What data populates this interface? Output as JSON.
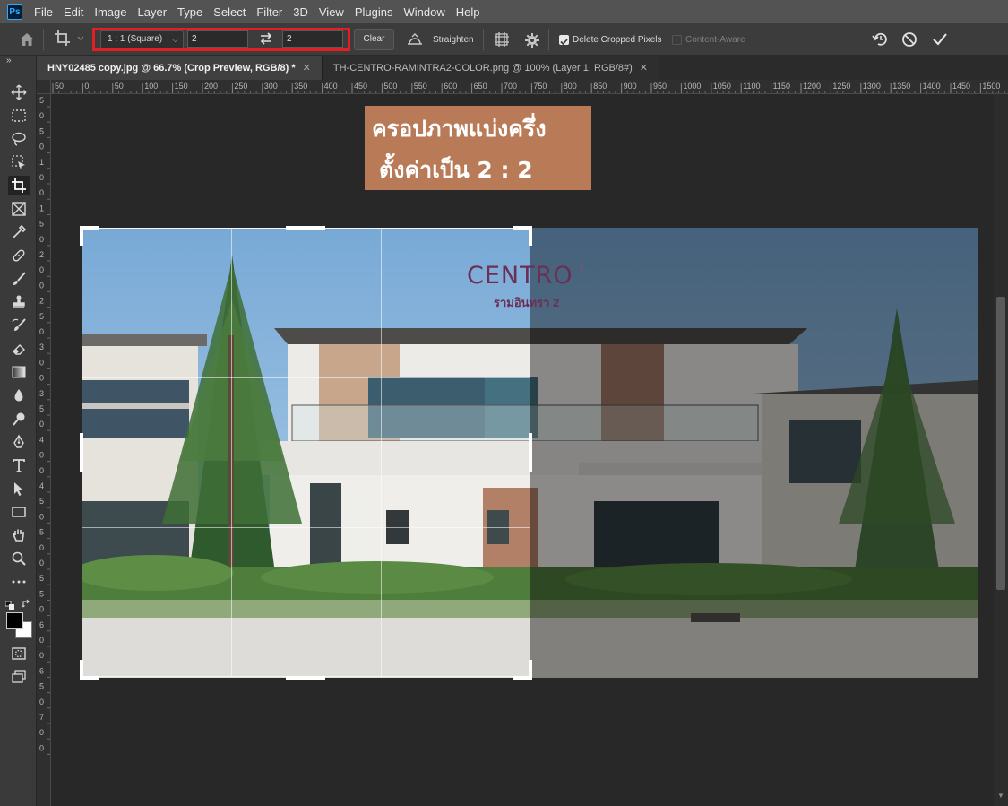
{
  "menu": [
    "File",
    "Edit",
    "Image",
    "Layer",
    "Type",
    "Select",
    "Filter",
    "3D",
    "View",
    "Plugins",
    "Window",
    "Help"
  ],
  "app_logo": "Ps",
  "options": {
    "ratio_preset": "1 : 1 (Square)",
    "width_value": "2",
    "height_value": "2",
    "clear_label": "Clear",
    "straighten_label": "Straighten",
    "delete_cropped_label": "Delete Cropped Pixels",
    "delete_cropped_checked": true,
    "content_aware_label": "Content-Aware",
    "content_aware_checked": false
  },
  "tabs": [
    {
      "label": "HNY02485 copy.jpg @ 66.7% (Crop Preview, RGB/8) *",
      "active": true
    },
    {
      "label": "TH-CENTRO-RAMINTRA2-COLOR.png @ 100% (Layer 1, RGB/8#)",
      "active": false
    }
  ],
  "ruler_top_labels": [
    "50",
    "0",
    "50",
    "100",
    "150",
    "200",
    "250",
    "300",
    "350",
    "400",
    "450",
    "500",
    "550",
    "600",
    "650",
    "700",
    "750",
    "800",
    "850",
    "900",
    "950",
    "1000",
    "1050",
    "1100",
    "1150",
    "1200",
    "1250",
    "1300",
    "1350",
    "1400",
    "1450",
    "1500"
  ],
  "ruler_left_labels": [
    "5",
    "0",
    "5",
    "0",
    "1",
    "0",
    "0",
    "1",
    "5",
    "0",
    "2",
    "0",
    "0",
    "2",
    "5",
    "0",
    "3",
    "0",
    "0",
    "3",
    "5",
    "0",
    "4",
    "0",
    "0",
    "4",
    "5",
    "0",
    "5",
    "0",
    "0",
    "5",
    "5",
    "0",
    "6",
    "0",
    "0",
    "6",
    "5",
    "0",
    "7",
    "0",
    "0"
  ],
  "annotation": {
    "line1": "ครอปภาพแบ่งครึ่ง",
    "line2": "ตั้งค่าเป็น 2 : 2"
  },
  "logo": {
    "name": "CENTRO",
    "sub": "รามอินทรา 2"
  },
  "colors": {
    "highlight": "#e31e24",
    "annotation_bg": "#b97b57",
    "logo": "#6b2f55",
    "workspace": "#282828"
  }
}
